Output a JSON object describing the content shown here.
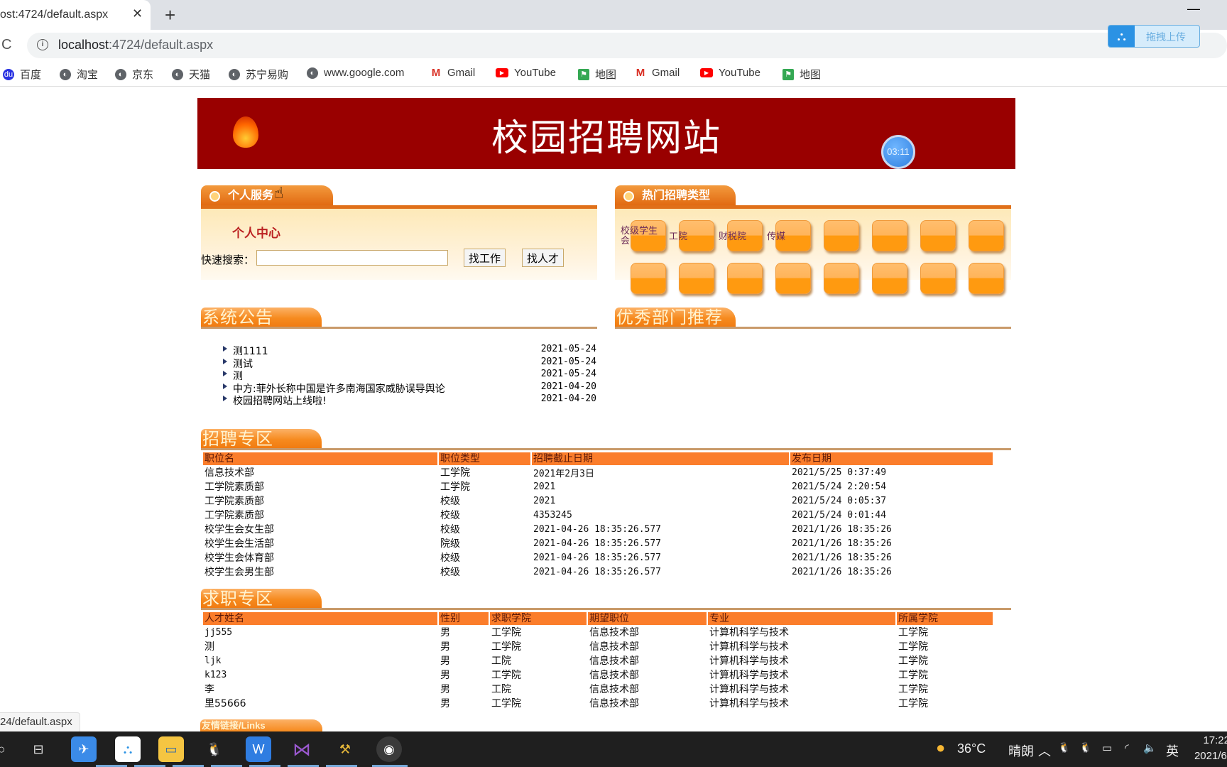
{
  "browser": {
    "tab_title": "ost:4724/default.aspx",
    "tab_close": "✕",
    "new_tab": "+",
    "minimize": "—",
    "reload": "C",
    "info": "i",
    "url_host": "localhost",
    "url_rest": ":4724/default.aspx",
    "star": "☆",
    "baidu_upload": {
      "icon": "⛬",
      "label": "拖拽上传"
    },
    "bookmarks": [
      {
        "label": "百度",
        "icon": "baidu-icon",
        "glyph": "du"
      },
      {
        "label": "淘宝",
        "icon": "globe-icon",
        "glyph": "◐"
      },
      {
        "label": "京东",
        "icon": "globe-icon",
        "glyph": "◐"
      },
      {
        "label": "天猫",
        "icon": "globe-icon",
        "glyph": "◐"
      },
      {
        "label": "苏宁易购",
        "icon": "globe-icon",
        "glyph": "◐"
      },
      {
        "label": "www.google.com",
        "icon": "globe-icon",
        "glyph": "◐"
      },
      {
        "label": "Gmail",
        "icon": "gmail-icon",
        "glyph": "M"
      },
      {
        "label": "YouTube",
        "icon": "youtube-icon",
        "glyph": "▶"
      },
      {
        "label": "地图",
        "icon": "maps-icon",
        "glyph": "⚑"
      },
      {
        "label": "Gmail",
        "icon": "gmail-icon",
        "glyph": "M"
      },
      {
        "label": "YouTube",
        "icon": "youtube-icon",
        "glyph": "▶"
      },
      {
        "label": "地图",
        "icon": "maps-icon",
        "glyph": "⚑"
      }
    ],
    "status_url": "24/default.aspx"
  },
  "banner": {
    "title": "校园招聘网站",
    "timer": "03:11"
  },
  "personal": {
    "header": "个人服务",
    "center_link": "个人中心",
    "search_label": "快速搜索：",
    "search_value": "",
    "find_job": "找工作",
    "find_talent": "找人才"
  },
  "hot_types": {
    "header": "热门招聘类型",
    "labels": [
      "校级学生会",
      "工院",
      "财税院",
      "传媒"
    ],
    "tile_count": 16
  },
  "notices": {
    "header": "系统公告",
    "items": [
      {
        "title": "测1111",
        "date": "2021-05-24"
      },
      {
        "title": "测试",
        "date": "2021-05-24"
      },
      {
        "title": "测",
        "date": "2021-05-24"
      },
      {
        "title": "中方:菲外长称中国是许多南海国家威胁误导舆论",
        "date": "2021-04-20"
      },
      {
        "title": "校园招聘网站上线啦!",
        "date": "2021-04-20"
      }
    ]
  },
  "departments": {
    "header": "优秀部门推荐"
  },
  "recruit": {
    "header": "招聘专区",
    "columns": [
      "职位名",
      "职位类型",
      "招聘截止日期",
      "发布日期"
    ],
    "rows": [
      [
        "信息技术部",
        "工学院",
        "2021年2月3日",
        "2021/5/25 0:37:49"
      ],
      [
        "工学院素质部",
        "工学院",
        "2021",
        "2021/5/24 2:20:54"
      ],
      [
        "工学院素质部",
        "校级",
        "2021",
        "2021/5/24 0:05:37"
      ],
      [
        "工学院素质部",
        "校级",
        "4353245",
        "2021/5/24 0:01:44"
      ],
      [
        "校学生会女生部",
        "校级",
        "2021-04-26 18:35:26.577",
        "2021/1/26 18:35:26"
      ],
      [
        "校学生会生活部",
        "院级",
        "2021-04-26 18:35:26.577",
        "2021/1/26 18:35:26"
      ],
      [
        "校学生会体育部",
        "校级",
        "2021-04-26 18:35:26.577",
        "2021/1/26 18:35:26"
      ],
      [
        "校学生会男生部",
        "校级",
        "2021-04-26 18:35:26.577",
        "2021/1/26 18:35:26"
      ]
    ]
  },
  "jobseek": {
    "header": "求职专区",
    "columns": [
      "人才姓名",
      "性别",
      "求职学院",
      "期望职位",
      "专业",
      "所属学院"
    ],
    "rows": [
      [
        "jj555",
        "男",
        "工学院",
        "信息技术部",
        "计算机科学与技术",
        "工学院"
      ],
      [
        "测",
        "男",
        "工学院",
        "信息技术部",
        "计算机科学与技术",
        "工学院"
      ],
      [
        "ljk",
        "男",
        "工院",
        "信息技术部",
        "计算机科学与技术",
        "工学院"
      ],
      [
        "k123",
        "男",
        "工学院",
        "信息技术部",
        "计算机科学与技术",
        "工学院"
      ],
      [
        "李",
        "男",
        "工院",
        "信息技术部",
        "计算机科学与技术",
        "工学院"
      ],
      [
        "里55666",
        "男",
        "工学院",
        "信息技术部",
        "计算机科学与技术",
        "工学院"
      ]
    ]
  },
  "links": {
    "header": "友情链接/Links"
  },
  "taskbar": {
    "weather_temp": "36°C",
    "weather_text": "晴朗",
    "ime": "英",
    "time": "17:22",
    "date": "2021/6/"
  }
}
